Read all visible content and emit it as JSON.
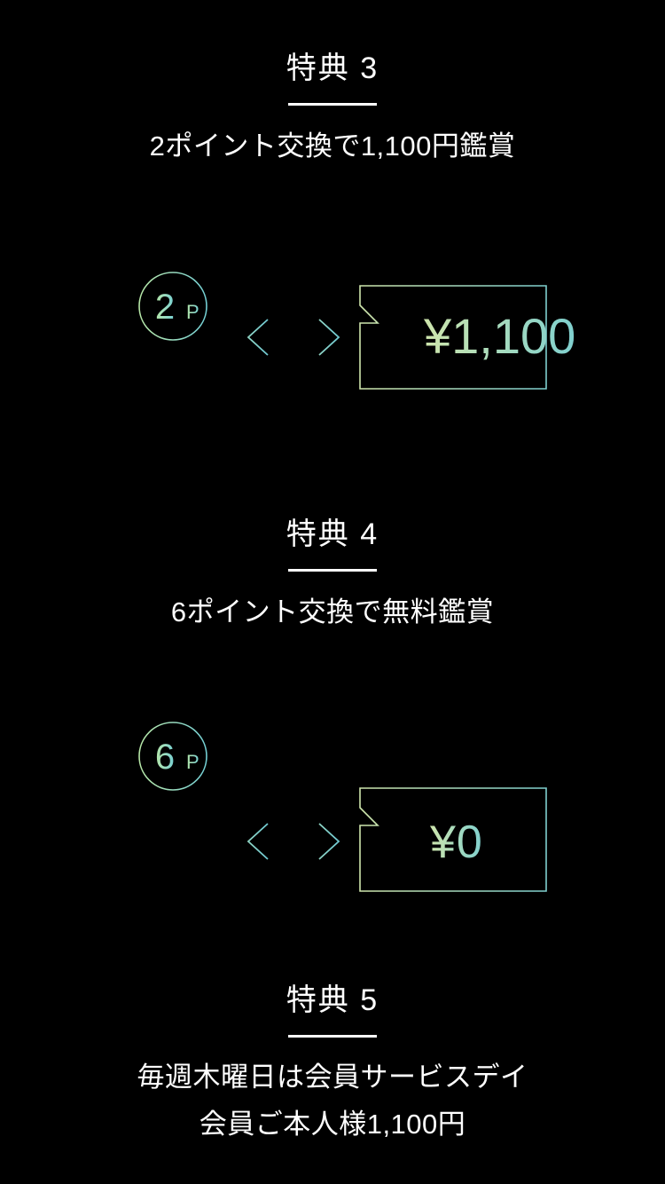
{
  "page": {
    "background_top_color": "#142c52",
    "background_bottom_color": "#000000",
    "accent_green": "#b9e6a8",
    "accent_teal": "#7fd4d0",
    "line_color": "#9fd8b8"
  },
  "sections": [
    {
      "id": "benefit-3",
      "title": "特典 3",
      "subtitle": "2ポイント交換で1,100円鑑賞",
      "illustration": {
        "coin_value": "2",
        "coin_unit": "P",
        "stack_lines": 2,
        "arrow": "double-arrow",
        "ticket_currency": "¥",
        "ticket_amount": "1,100"
      }
    },
    {
      "id": "benefit-4",
      "title": "特典 4",
      "subtitle": "6ポイント交換で無料鑑賞",
      "illustration": {
        "coin_value": "6",
        "coin_unit": "P",
        "stack_lines": 6,
        "arrow": "double-arrow",
        "ticket_currency": "¥",
        "ticket_amount": "0"
      }
    },
    {
      "id": "benefit-5",
      "title": "特典 5",
      "subtitle_line1": "毎週木曜日は会員サービスデイ",
      "subtitle_line2": "会員ご本人様1,100円"
    }
  ]
}
